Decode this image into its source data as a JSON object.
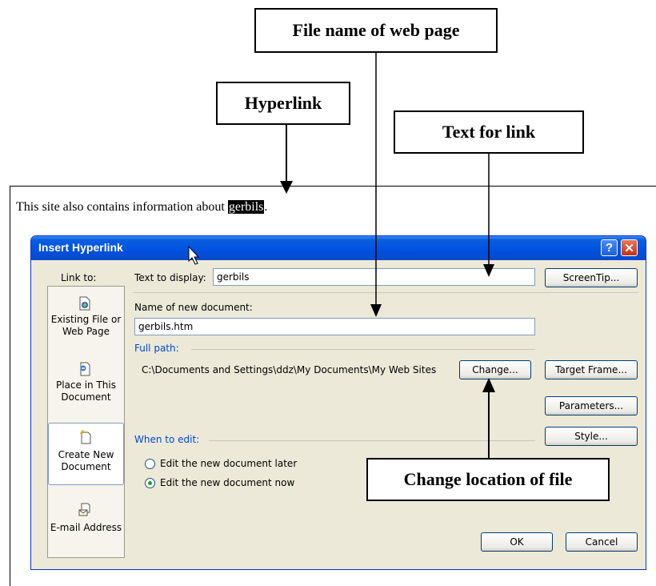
{
  "callouts": {
    "file_name": "File name of web page",
    "hyperlink": "Hyperlink",
    "text_for_link": "Text for link",
    "change_location": "Change location of file"
  },
  "document": {
    "line_prefix": "This site also contains information about ",
    "link_text": "gerbils",
    "line_suffix": "."
  },
  "dialog": {
    "title": "Insert Hyperlink",
    "help_glyph": "?",
    "close_glyph": "✕",
    "link_to_label": "Link to:",
    "sidebar": {
      "existing_line1": "Existing File or",
      "existing_line2": "Web Page",
      "place_line1": "Place in This",
      "place_line2": "Document",
      "create_line1": "Create New",
      "create_line2": "Document",
      "email": "E-mail Address"
    },
    "text_to_display_label": "Text to display:",
    "text_to_display_value": "gerbils",
    "screentip_button": "ScreenTip...",
    "name_label": "Name of new document:",
    "name_value": "gerbils.htm",
    "full_path_label": "Full path:",
    "full_path_value": "C:\\Documents and Settings\\ddz\\My Documents\\My Web Sites",
    "change_button": "Change...",
    "target_frame_button": "Target Frame...",
    "parameters_button": "Parameters...",
    "style_button": "Style...",
    "when_to_edit_label": "When to edit:",
    "radio_later": "Edit the new document later",
    "radio_now": "Edit the new document now",
    "ok_button": "OK",
    "cancel_button": "Cancel"
  },
  "colors": {
    "titlebar": "#0050e0",
    "dialog_bg": "#ece9d8",
    "section_label": "#0046d5"
  },
  "icons": [
    "help-icon",
    "close-icon",
    "existing-file-icon",
    "place-in-document-icon",
    "create-new-document-icon",
    "email-address-icon",
    "mouse-cursor-icon"
  ]
}
